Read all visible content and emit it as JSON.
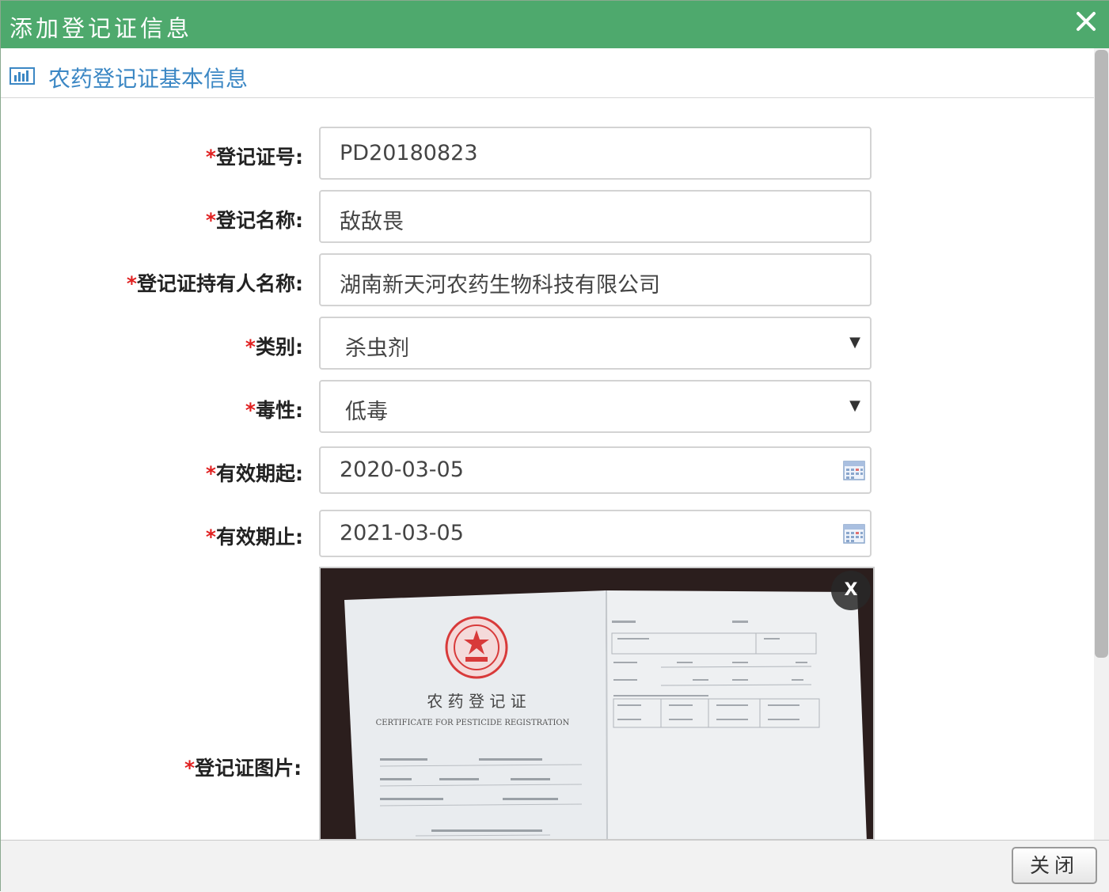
{
  "dialog": {
    "title": "添加登记证信息",
    "section_title": "农药登记证基本信息",
    "close_button_label": "关闭",
    "remove_image_label": "X"
  },
  "form": {
    "required_mark": "*",
    "fields": [
      {
        "label": "登记证号:",
        "value": "PD20180823",
        "type": "text"
      },
      {
        "label": "登记名称:",
        "value": "敌敌畏",
        "type": "text"
      },
      {
        "label": "登记证持有人名称:",
        "value": "湖南新天河农药生物科技有限公司",
        "type": "text"
      },
      {
        "label": "类别:",
        "value": "杀虫剂",
        "type": "select"
      },
      {
        "label": "毒性:",
        "value": "低毒",
        "type": "select"
      },
      {
        "label": "有效期起:",
        "value": "2020-03-05",
        "type": "date"
      },
      {
        "label": "有效期止:",
        "value": "2021-03-05",
        "type": "date"
      }
    ],
    "image_label": "登记证图片:"
  },
  "certificate_image": {
    "title_cn": "农 药 登 记 证",
    "title_en": "CERTIFICATE FOR PESTICIDE REGISTRATION"
  },
  "colors": {
    "title_bar": "#4ea96d",
    "section_title": "#3b87c4",
    "required": "#e02020"
  }
}
